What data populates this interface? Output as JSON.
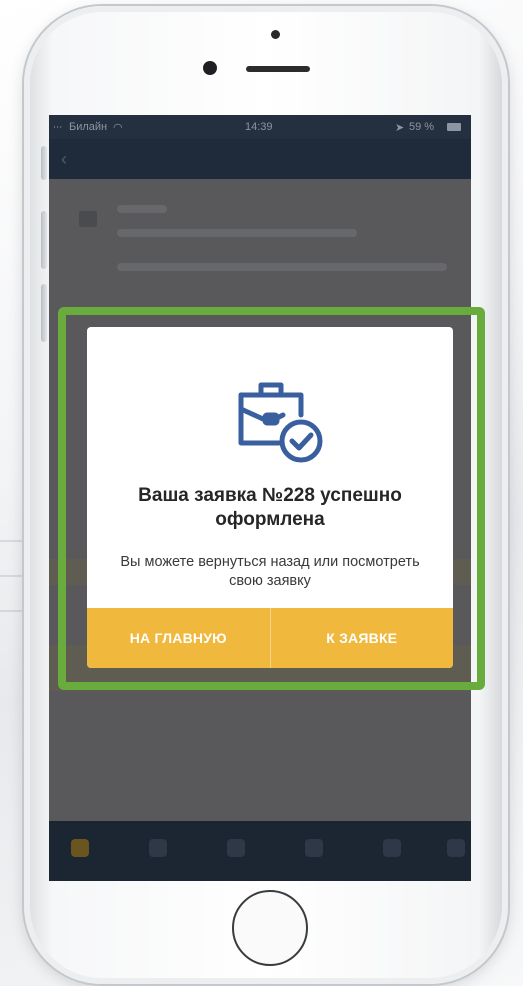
{
  "status_bar": {
    "carrier": "Билайн",
    "time": "14:39",
    "battery": "59 %"
  },
  "dialog": {
    "title": "Ваша заявка №228 успешно оформлена",
    "message": "Вы можете вернуться назад или посмотреть свою заявку",
    "buttons": {
      "home_label": "НА ГЛАВНУЮ",
      "request_label": "К ЗАЯВКЕ"
    },
    "icon": "briefcase-check-icon"
  },
  "colors": {
    "accent": "#f0b83c",
    "highlight": "#6aab3e",
    "icon_blue": "#3a5f9e"
  }
}
